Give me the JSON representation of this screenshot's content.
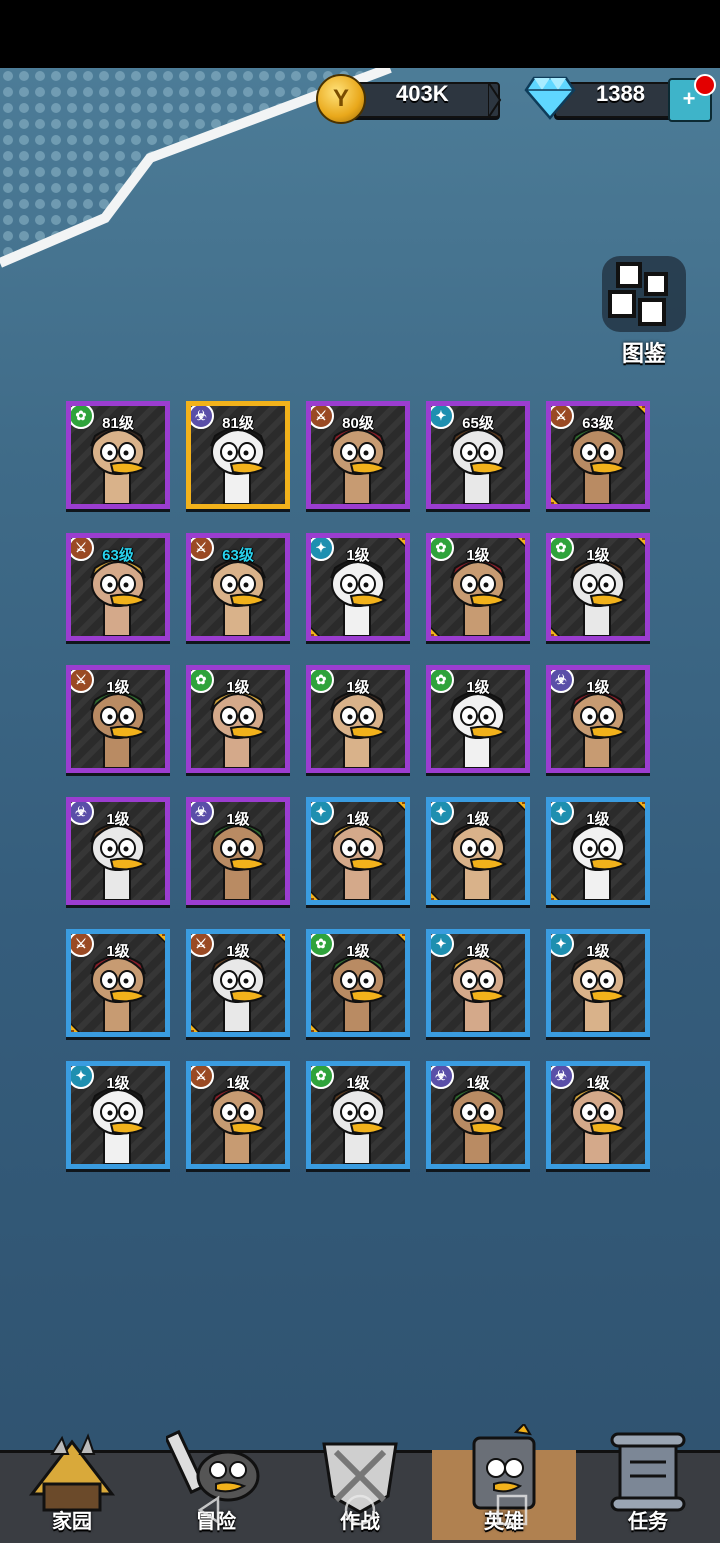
{
  "currencies": {
    "coin": {
      "icon": "coin-icon",
      "symbol": "Y",
      "value": "403K"
    },
    "gem": {
      "icon": "diamond-icon",
      "value": "1388"
    }
  },
  "codex": {
    "label": "图鉴",
    "icon": "grid-book-icon"
  },
  "heroes": [
    {
      "level": "81级",
      "cls": "green",
      "frame": "purple"
    },
    {
      "level": "81级",
      "cls": "purple",
      "frame": "gold"
    },
    {
      "level": "80级",
      "cls": "brown",
      "frame": "purple"
    },
    {
      "level": "65级",
      "cls": "teal",
      "frame": "purple"
    },
    {
      "level": "63级",
      "cls": "brown",
      "frame": "purple",
      "corners": true
    },
    {
      "level": "63级",
      "cls": "brown",
      "frame": "purple",
      "cyan": true
    },
    {
      "level": "63级",
      "cls": "brown",
      "frame": "purple",
      "cyan": true
    },
    {
      "level": "1级",
      "cls": "teal",
      "frame": "purple",
      "corners": true
    },
    {
      "level": "1级",
      "cls": "green",
      "frame": "purple",
      "corners": true
    },
    {
      "level": "1级",
      "cls": "green",
      "frame": "purple",
      "corners": true
    },
    {
      "level": "1级",
      "cls": "brown",
      "frame": "purple"
    },
    {
      "level": "1级",
      "cls": "green",
      "frame": "purple"
    },
    {
      "level": "1级",
      "cls": "green",
      "frame": "purple"
    },
    {
      "level": "1级",
      "cls": "green",
      "frame": "purple"
    },
    {
      "level": "1级",
      "cls": "purple",
      "frame": "purple"
    },
    {
      "level": "1级",
      "cls": "purple",
      "frame": "purple"
    },
    {
      "level": "1级",
      "cls": "purple",
      "frame": "purple"
    },
    {
      "level": "1级",
      "cls": "teal",
      "frame": "blue",
      "corners": true
    },
    {
      "level": "1级",
      "cls": "teal",
      "frame": "blue",
      "corners": true
    },
    {
      "level": "1级",
      "cls": "teal",
      "frame": "blue",
      "corners": true
    },
    {
      "level": "1级",
      "cls": "brown",
      "frame": "blue",
      "corners": true
    },
    {
      "level": "1级",
      "cls": "brown",
      "frame": "blue",
      "corners": true
    },
    {
      "level": "1级",
      "cls": "green",
      "frame": "blue",
      "corners": true
    },
    {
      "level": "1级",
      "cls": "teal",
      "frame": "blue"
    },
    {
      "level": "1级",
      "cls": "teal",
      "frame": "blue"
    },
    {
      "level": "1级",
      "cls": "teal",
      "frame": "blue"
    },
    {
      "level": "1级",
      "cls": "brown",
      "frame": "blue"
    },
    {
      "level": "1级",
      "cls": "green",
      "frame": "blue"
    },
    {
      "level": "1级",
      "cls": "purple",
      "frame": "blue"
    },
    {
      "level": "1级",
      "cls": "purple",
      "frame": "blue"
    }
  ],
  "nav": [
    {
      "label": "家园",
      "icon": "home-tent-icon",
      "active": false
    },
    {
      "label": "冒险",
      "icon": "adventure-duck-icon",
      "active": false
    },
    {
      "label": "作战",
      "icon": "battle-swords-icon",
      "active": false
    },
    {
      "label": "英雄",
      "icon": "hero-book-icon",
      "active": true
    },
    {
      "label": "任务",
      "icon": "quest-scroll-icon",
      "active": false
    }
  ],
  "colors": {
    "frame_purple": "#9b3dd0",
    "frame_gold": "#f2b21b",
    "frame_blue": "#3a9ce0",
    "class_green": "#2fa33b",
    "class_brown": "#9a4a24",
    "class_teal": "#1e8fb0",
    "class_purple": "#5a4fa8",
    "level_cyan": "#29d3ee"
  }
}
